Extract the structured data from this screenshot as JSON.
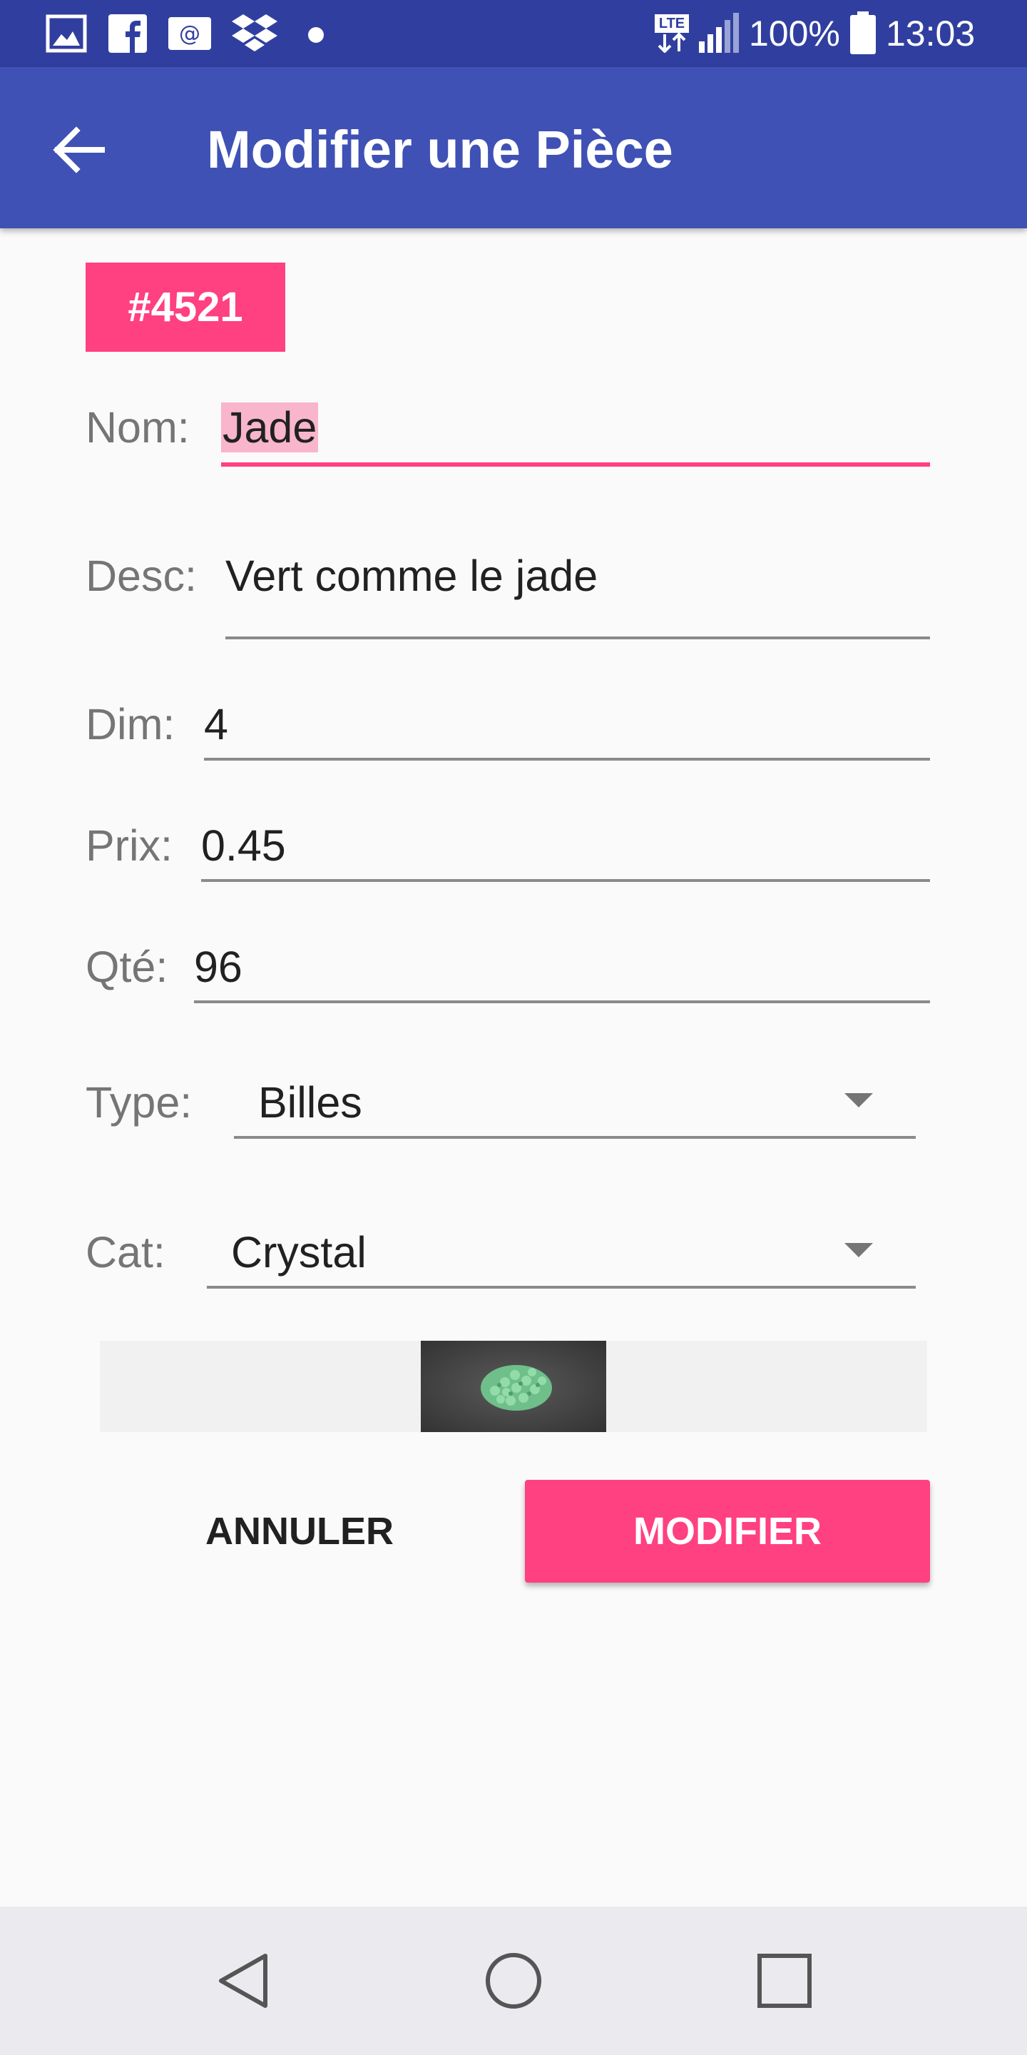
{
  "status_bar": {
    "network_type": "LTE",
    "battery_percent": "100%",
    "time": "13:03",
    "notification_icons": [
      "gallery-icon",
      "facebook-icon",
      "email-icon",
      "dropbox-icon",
      "dot-icon"
    ]
  },
  "app_bar": {
    "title": "Modifier une Pièce",
    "back_icon": "arrow-back-icon"
  },
  "item": {
    "id_badge": "#4521"
  },
  "form": {
    "nom": {
      "label": "Nom:",
      "value": "Jade"
    },
    "desc": {
      "label": "Desc:",
      "value": "Vert comme le jade"
    },
    "dim": {
      "label": "Dim:",
      "value": "4"
    },
    "prix": {
      "label": "Prix:",
      "value": "0.45"
    },
    "qte": {
      "label": "Qté:",
      "value": "96"
    },
    "type": {
      "label": "Type:",
      "selected": "Billes"
    },
    "cat": {
      "label": "Cat:",
      "selected": "Crystal"
    }
  },
  "actions": {
    "cancel_label": "ANNULER",
    "modify_label": "MODIFIER"
  },
  "nav_bar": {
    "icons": [
      "back-triangle-icon",
      "home-circle-icon",
      "recents-square-icon"
    ]
  },
  "colors": {
    "status_bar": "#303f9f",
    "app_bar": "#3f51b5",
    "accent": "#ff4081",
    "text_primary": "#212121",
    "text_secondary": "#757575"
  }
}
